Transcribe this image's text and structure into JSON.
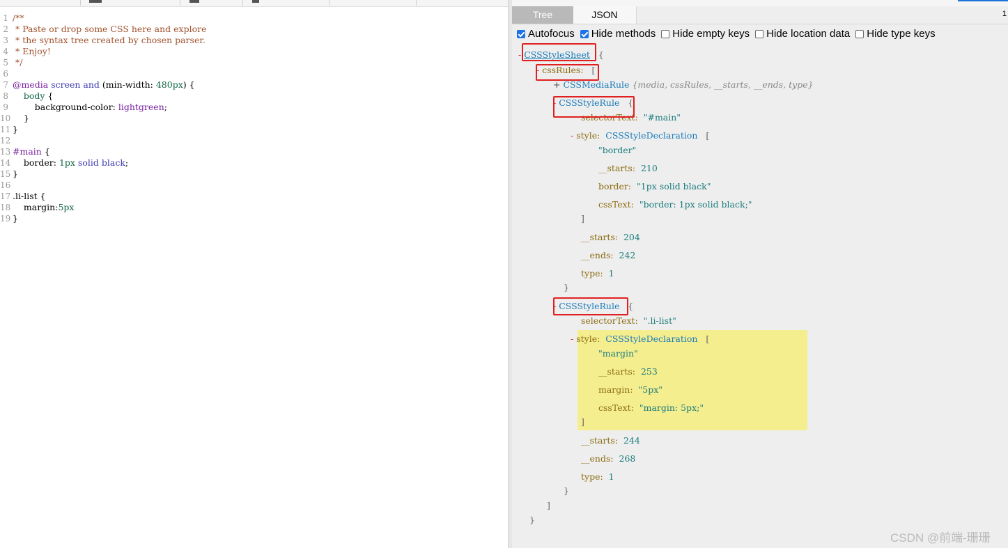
{
  "toolbar": {},
  "editor": {
    "lines": [
      {
        "n": "1",
        "parts": [
          [
            "c-comment",
            "/**"
          ]
        ]
      },
      {
        "n": "2",
        "parts": [
          [
            "c-comment",
            " * Paste or drop some CSS here and explore"
          ]
        ]
      },
      {
        "n": "3",
        "parts": [
          [
            "c-comment",
            " * the syntax tree created by chosen parser."
          ]
        ]
      },
      {
        "n": "4",
        "parts": [
          [
            "c-comment",
            " * Enjoy!"
          ]
        ]
      },
      {
        "n": "5",
        "parts": [
          [
            "c-comment",
            " */"
          ]
        ]
      },
      {
        "n": "6",
        "parts": []
      },
      {
        "n": "7",
        "parts": [
          [
            "c-at",
            "@media "
          ],
          [
            "c-kw",
            "screen "
          ],
          [
            "c-kw",
            "and "
          ],
          [
            "",
            "(min-width: "
          ],
          [
            "c-num",
            "480px"
          ],
          [
            "",
            ") {"
          ]
        ]
      },
      {
        "n": "8",
        "parts": [
          [
            "c-num",
            "    body "
          ],
          [
            "",
            "{"
          ]
        ]
      },
      {
        "n": "9",
        "parts": [
          [
            "",
            "        background-color: "
          ],
          [
            "c-val",
            "lightgreen"
          ],
          [
            "",
            ";"
          ]
        ]
      },
      {
        "n": "10",
        "parts": [
          [
            "",
            "    }"
          ]
        ]
      },
      {
        "n": "11",
        "parts": [
          [
            "",
            "}"
          ]
        ]
      },
      {
        "n": "12",
        "parts": []
      },
      {
        "n": "13",
        "parts": [
          [
            "c-at",
            "#main "
          ],
          [
            "",
            "{"
          ]
        ]
      },
      {
        "n": "14",
        "parts": [
          [
            "",
            "    border: "
          ],
          [
            "c-num",
            "1px "
          ],
          [
            "c-kw",
            "solid "
          ],
          [
            "c-kw",
            "black"
          ],
          [
            "",
            ";"
          ]
        ]
      },
      {
        "n": "15",
        "parts": [
          [
            "",
            "}"
          ]
        ]
      },
      {
        "n": "16",
        "parts": []
      },
      {
        "n": "17",
        "parts": [
          [
            "",
            ".li-list {"
          ]
        ]
      },
      {
        "n": "18",
        "parts": [
          [
            "",
            "    margin:"
          ],
          [
            "c-num",
            "5px"
          ]
        ]
      },
      {
        "n": "19",
        "parts": [
          [
            "",
            "}"
          ]
        ]
      }
    ]
  },
  "tabs": {
    "tree": "Tree",
    "json": "JSON",
    "count": "1"
  },
  "options": [
    {
      "label": "Autofocus",
      "checked": true
    },
    {
      "label": "Hide methods",
      "checked": true
    },
    {
      "label": "Hide empty keys",
      "checked": false
    },
    {
      "label": "Hide location data",
      "checked": false
    },
    {
      "label": "Hide type keys",
      "checked": false
    }
  ],
  "tree": {
    "root_toggle": "-",
    "root_name": "CSSStyleSheet",
    "open_brace": "{",
    "css_rules_key": "cssRules:",
    "open_bracket": "[",
    "media_rule_toggle": "+",
    "media_rule_name": "CSSMediaRule",
    "media_rule_meta": "{media, cssRules, __starts, __ends, type}",
    "rule1": {
      "name": "CSSStyleRule",
      "selector_key": "selectorText:",
      "selector_val": "\"#main\"",
      "style_key": "style:",
      "style_type": "CSSStyleDeclaration",
      "item0": "\"border\"",
      "starts_key": "__starts:",
      "starts_val": "210",
      "prop_key": "border:",
      "prop_val": "\"1px solid black\"",
      "csstext_key": "cssText:",
      "csstext_val": "\"border: 1px solid black;\"",
      "rule_starts_val": "204",
      "ends_key": "__ends:",
      "rule_ends_val": "242",
      "type_key": "type:",
      "type_val": "1"
    },
    "rule2": {
      "name": "CSSStyleRule",
      "selector_key": "selectorText:",
      "selector_val": "\".li-list\"",
      "style_key": "style:",
      "style_type": "CSSStyleDeclaration",
      "item0": "\"margin\"",
      "starts_key": "__starts:",
      "starts_val": "253",
      "prop_key": "margin:",
      "prop_val": "\"5px\"",
      "csstext_key": "cssText:",
      "csstext_val": "\"margin: 5px;\"",
      "rule_starts_val": "244",
      "ends_key": "__ends:",
      "rule_ends_val": "268",
      "type_key": "type:",
      "type_val": "1"
    },
    "close_bracket": "]",
    "close_brace": "}"
  },
  "watermark": "CSDN @前端-珊珊"
}
